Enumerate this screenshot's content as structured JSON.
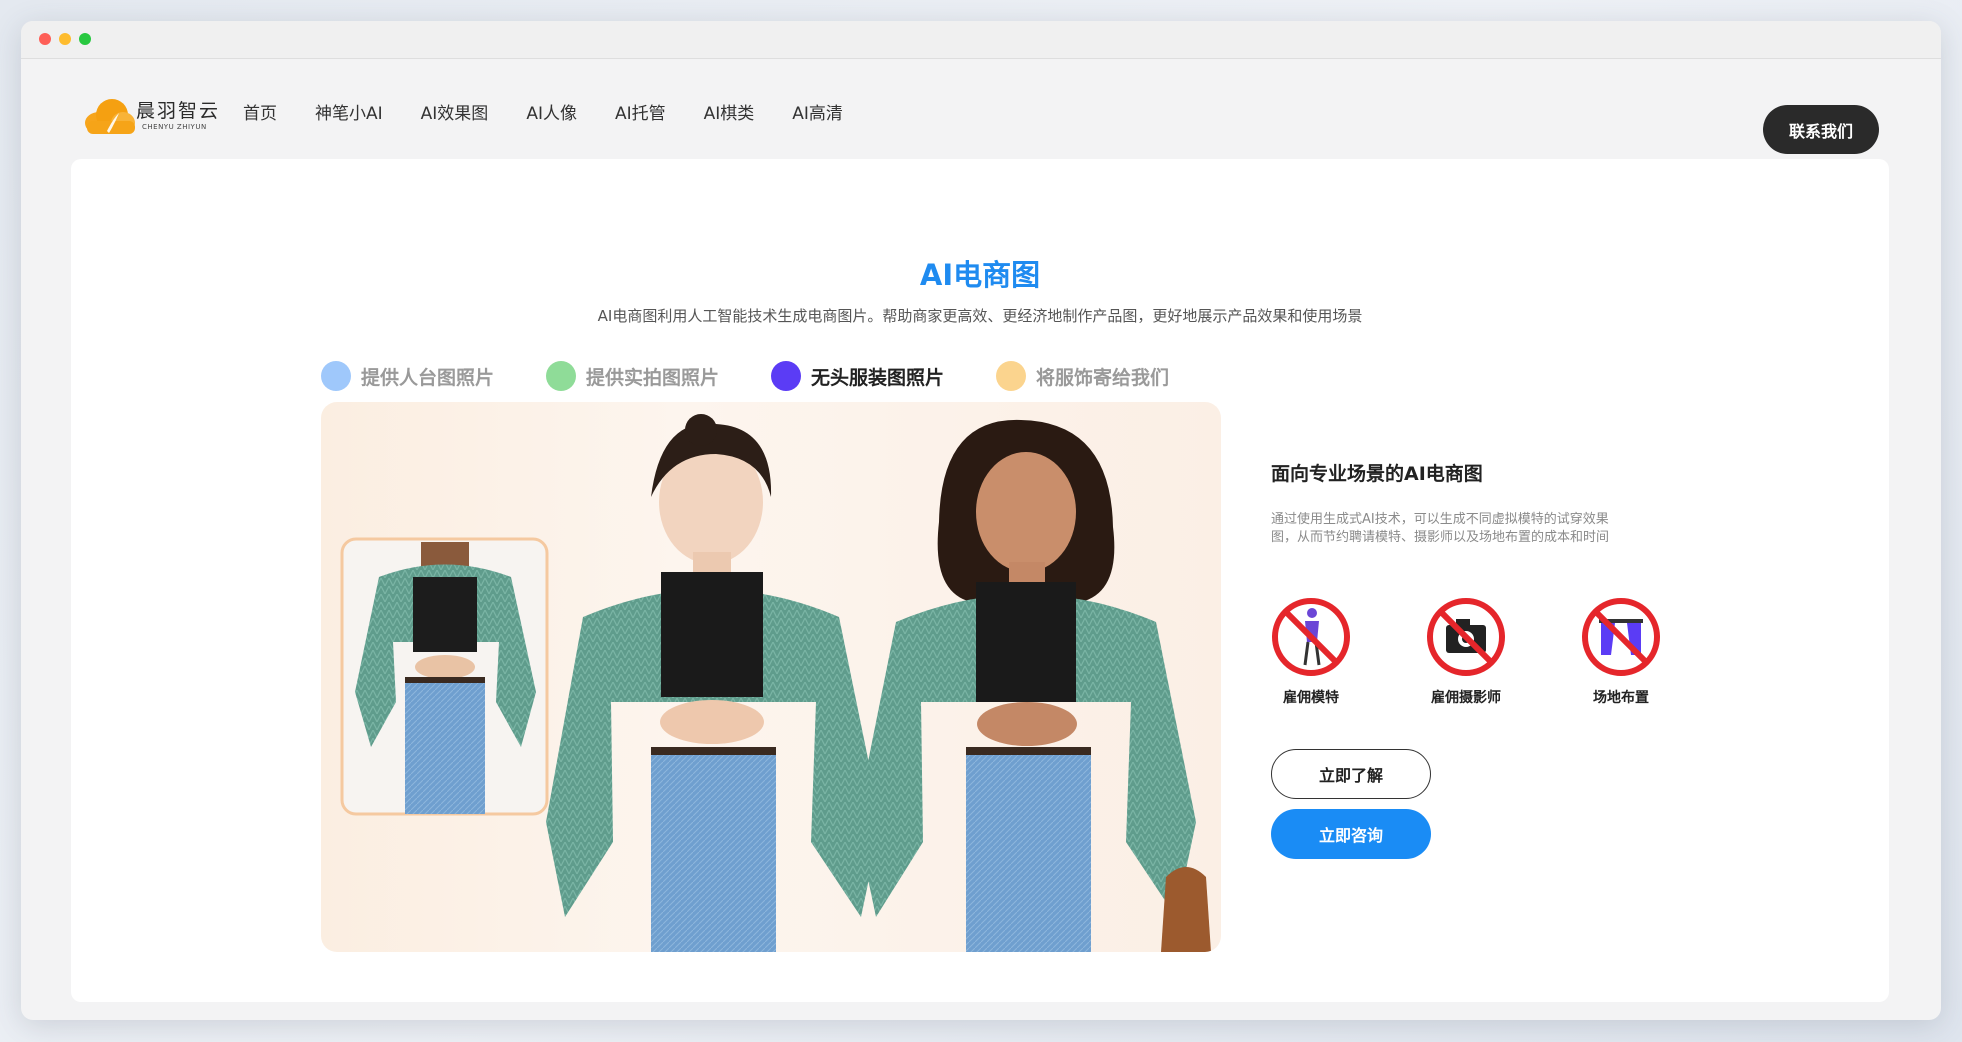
{
  "header": {
    "logo_text": "晨羽智云",
    "logo_sub": "CHENYU ZHIYUN",
    "nav": [
      "首页",
      "神笔小AI",
      "AI效果图",
      "AI人像",
      "AI托管",
      "AI棋类",
      "AI高清"
    ],
    "contact_label": "联系我们"
  },
  "main": {
    "title": "AI电商图",
    "description": "AI电商图利用人工智能技术生成电商图片。帮助商家更高效、更经济地制作产品图，更好地展示产品效果和使用场景",
    "tabs": [
      {
        "label": "提供人台图照片",
        "color": "#9fc8fb"
      },
      {
        "label": "提供实拍图照片",
        "color": "#8fdc98"
      },
      {
        "label": "无头服装图照片",
        "color": "#5b3cf5"
      },
      {
        "label": "将服饰寄给我们",
        "color": "#fbd48e"
      }
    ],
    "active_tab": 2
  },
  "side": {
    "title": "面向专业场景的AI电商图",
    "description": "通过使用生成式AI技术，可以生成不同虚拟模特的试穿效果图，从而节约聘请模特、摄影师以及场地布置的成本和时间",
    "features": [
      {
        "label": "雇佣模特",
        "icon": "no-model-icon"
      },
      {
        "label": "雇佣摄影师",
        "icon": "no-camera-icon"
      },
      {
        "label": "场地布置",
        "icon": "no-venue-icon"
      }
    ],
    "learn_label": "立即了解",
    "consult_label": "立即咨询"
  },
  "colors": {
    "accent": "#1f8bf0",
    "consult_button": "#1a8cf5",
    "contact_button": "#2a2a2a",
    "prohibit_red": "#e5262b"
  }
}
